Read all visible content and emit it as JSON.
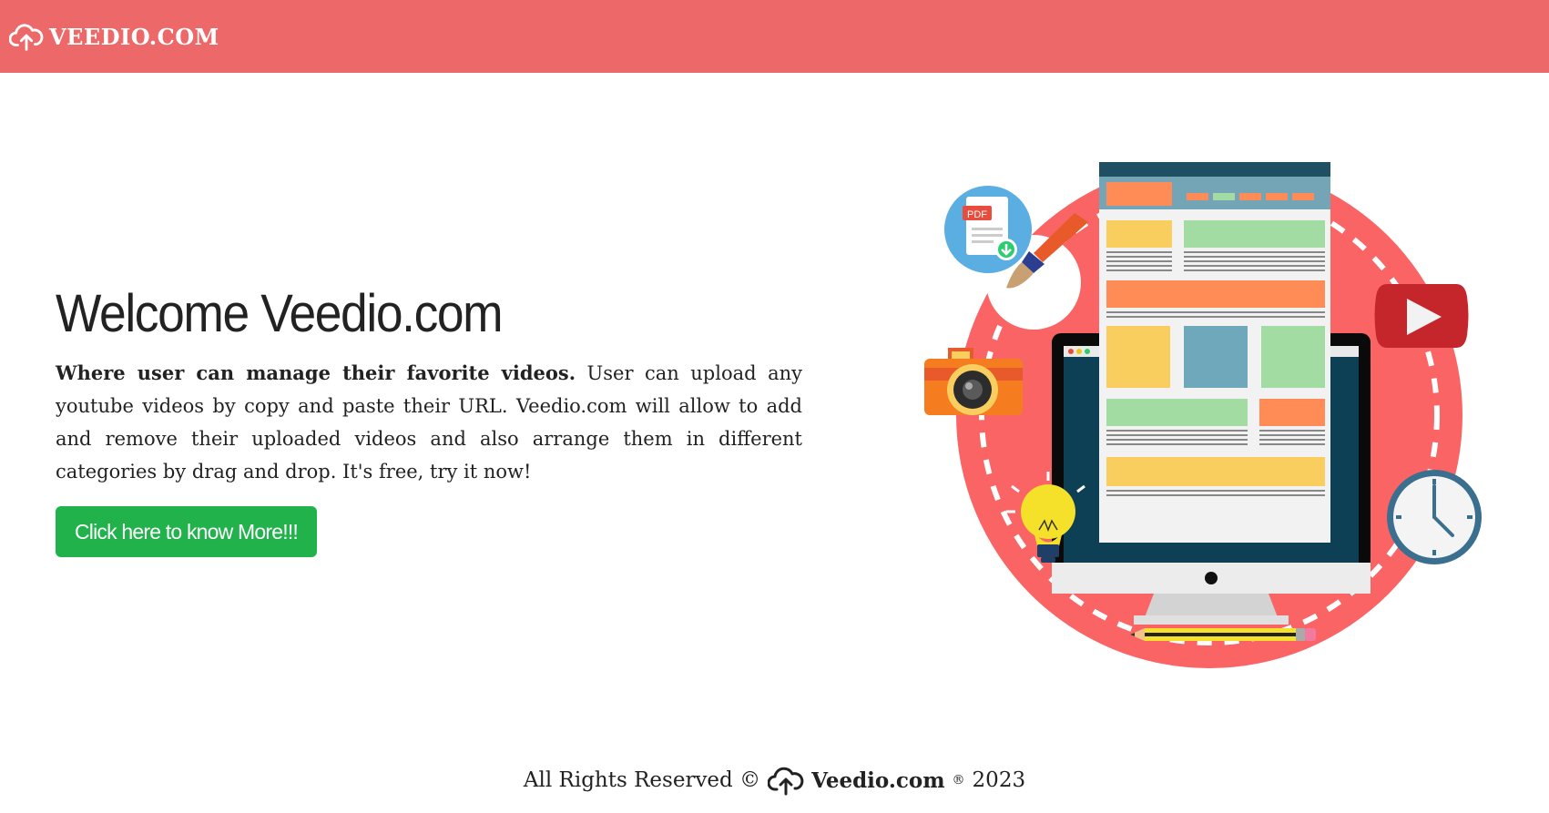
{
  "header": {
    "brand": "VEEDIO.COM",
    "logo_icon": "cloud-upload-icon",
    "bg_color": "#ed6868"
  },
  "hero": {
    "title": "Welcome Veedio.com",
    "lead_bold": "Where user can manage their favorite videos.",
    "lead_text": " User can upload any youtube videos by copy and paste their URL. Veedio.com will allow to add and remove their uploaded videos and also arrange them in different categories by drag and drop. It's free, try it now!",
    "cta_label": "Click here to know More!!!",
    "cta_color": "#21b24b"
  },
  "illustration": {
    "pdf_badge": "PDF",
    "icons": [
      "pdf-download-icon",
      "paintbrush-icon",
      "camera-icon",
      "youtube-play-icon",
      "lightbulb-icon",
      "clock-icon",
      "pencil-icon",
      "monitor-icon"
    ]
  },
  "footer": {
    "prefix": "All Rights Reserved ©",
    "brand": "Veedio.com",
    "registered": "®",
    "year": "2023",
    "icon": "cloud-upload-icon"
  }
}
